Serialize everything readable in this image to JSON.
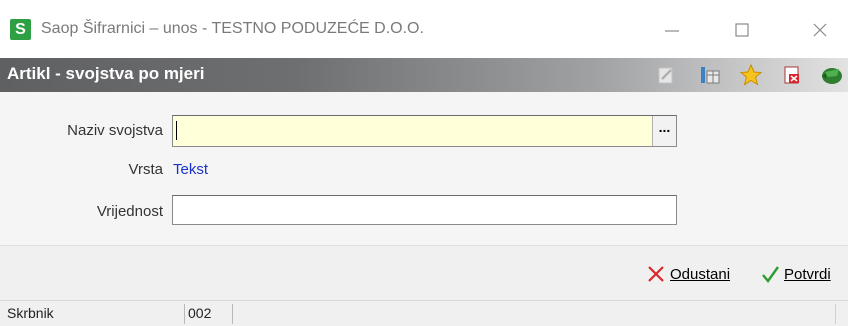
{
  "window": {
    "app_icon_letter": "S",
    "title": "Saop Šifrarnici – unos - TESTNO PODUZEĆE D.O.O.",
    "minimize": "—",
    "maximize": "☐",
    "close": "✕"
  },
  "header": {
    "title": "Artikl - svojstva po mjeri",
    "icons": [
      "edit-icon",
      "columns-icon",
      "favorite-star-icon",
      "delete-document-icon",
      "exit-icon"
    ]
  },
  "form": {
    "naziv_label": "Naziv svojstva",
    "naziv_value": "",
    "naziv_button": "...",
    "vrsta_label": "Vrsta",
    "vrsta_value": "Tekst",
    "vrijednost_label": "Vrijednost",
    "vrijednost_value": ""
  },
  "footer": {
    "cancel_label": "Odustani",
    "confirm_label": "Potvrdi"
  },
  "status": {
    "user": "Skrbnik",
    "code": "002",
    "message": ""
  },
  "colors": {
    "header_dark": "#5f6062",
    "field_focus": "#ffffd9",
    "link_blue": "#1a33cc",
    "cancel_red": "#d8262c",
    "confirm_green": "#2e9c2e"
  }
}
